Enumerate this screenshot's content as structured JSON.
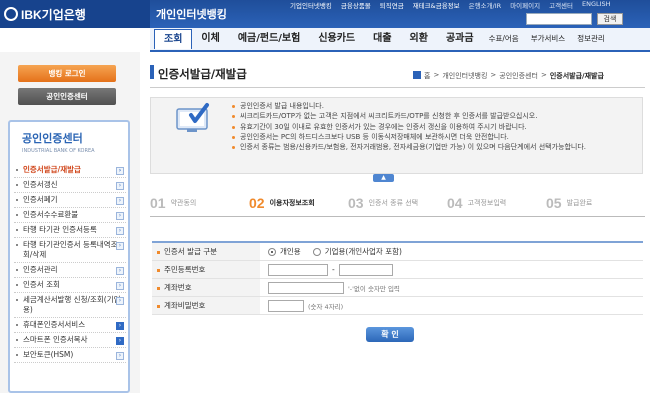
{
  "brand": {
    "logo_text": "IBK기업은행",
    "service_title": "개인인터넷뱅킹"
  },
  "top_links": [
    "기업인터넷뱅킹",
    "금융상품몰",
    "퇴직연금",
    "재테크&금융정보",
    "은행소개/IR",
    "마이페이지",
    "고객센터",
    "ENGLISH"
  ],
  "search": {
    "button": "검색"
  },
  "gnb": {
    "tabs": [
      "조회",
      "이체",
      "예금/펀드/보험",
      "신용카드",
      "대출",
      "외환",
      "공과금"
    ],
    "small_tabs": [
      "수표/어음",
      "부가서비스",
      "정보관리"
    ]
  },
  "sidebar": {
    "login_button": "뱅킹 로그인",
    "center_button": "공인인증센터",
    "heading": "공인인증센터",
    "subheading": "INDUSTRIAL BANK OF KOREA",
    "items": [
      {
        "label": "인증서발급/재발급",
        "active": true
      },
      {
        "label": "인증서갱신"
      },
      {
        "label": "인증서폐기"
      },
      {
        "label": "인증서수수료환불"
      },
      {
        "label": "타행 타기관 인증서등록"
      },
      {
        "label": "타행 타기관인증서 등록내역조회/삭제"
      },
      {
        "label": "인증서관리"
      },
      {
        "label": "인증서 조회"
      },
      {
        "label": "세금계산서발행 신청/조회(기업용)"
      },
      {
        "label": "휴대폰인증서서비스",
        "blue": true
      },
      {
        "label": "스마트폰 인증서복사",
        "blue": true
      },
      {
        "label": "보안토큰(HSM)"
      }
    ]
  },
  "page": {
    "title": "인증서발급/재발급",
    "breadcrumb": [
      "홈",
      "개인인터넷뱅킹",
      "공인인증센터",
      "인증서발급/재발급"
    ]
  },
  "info": [
    "공인인증서 발급 내용입니다.",
    "씨크리트카드/OTP가 없는 고객은 지점에서 씨크리트카드/OTP를 신청한 후 인증서를 발급받으십시오.",
    "유효기간이 30일 이내로 유효한 인증서가 있는 경우에는 인증서 갱신을 이용하여 주시기 바랍니다.",
    "공인인증서는 PC의 하드디스크보다 USB 등 이동식저장매체에 보관하시면 더욱 안전합니다.",
    "인증서 종류는 범용/신용카드/보험용, 전자거래범용, 전자세금용(기업만 가능) 이 있으며 다음단계에서 선택가능합니다."
  ],
  "steps": [
    {
      "num": "01",
      "label": "약관동의"
    },
    {
      "num": "02",
      "label": "이용자정보조회",
      "current": true
    },
    {
      "num": "03",
      "label": "인증서 종류 선택"
    },
    {
      "num": "04",
      "label": "고객정보입력"
    },
    {
      "num": "05",
      "label": "발급완료"
    }
  ],
  "form": {
    "row1": {
      "label": "인증서 발급 구분",
      "opt1": "개인용",
      "opt2": "기업용(개인사업자 포함)"
    },
    "row2": {
      "label": "주민등록번호",
      "sep": "-"
    },
    "row3": {
      "label": "계좌번호",
      "hint": "'-'없이 숫자만 입력"
    },
    "row4": {
      "label": "계좌비밀번호",
      "hint": "(숫자 4자리)"
    }
  },
  "confirm_button": "확 인",
  "collapse_label": "▲"
}
